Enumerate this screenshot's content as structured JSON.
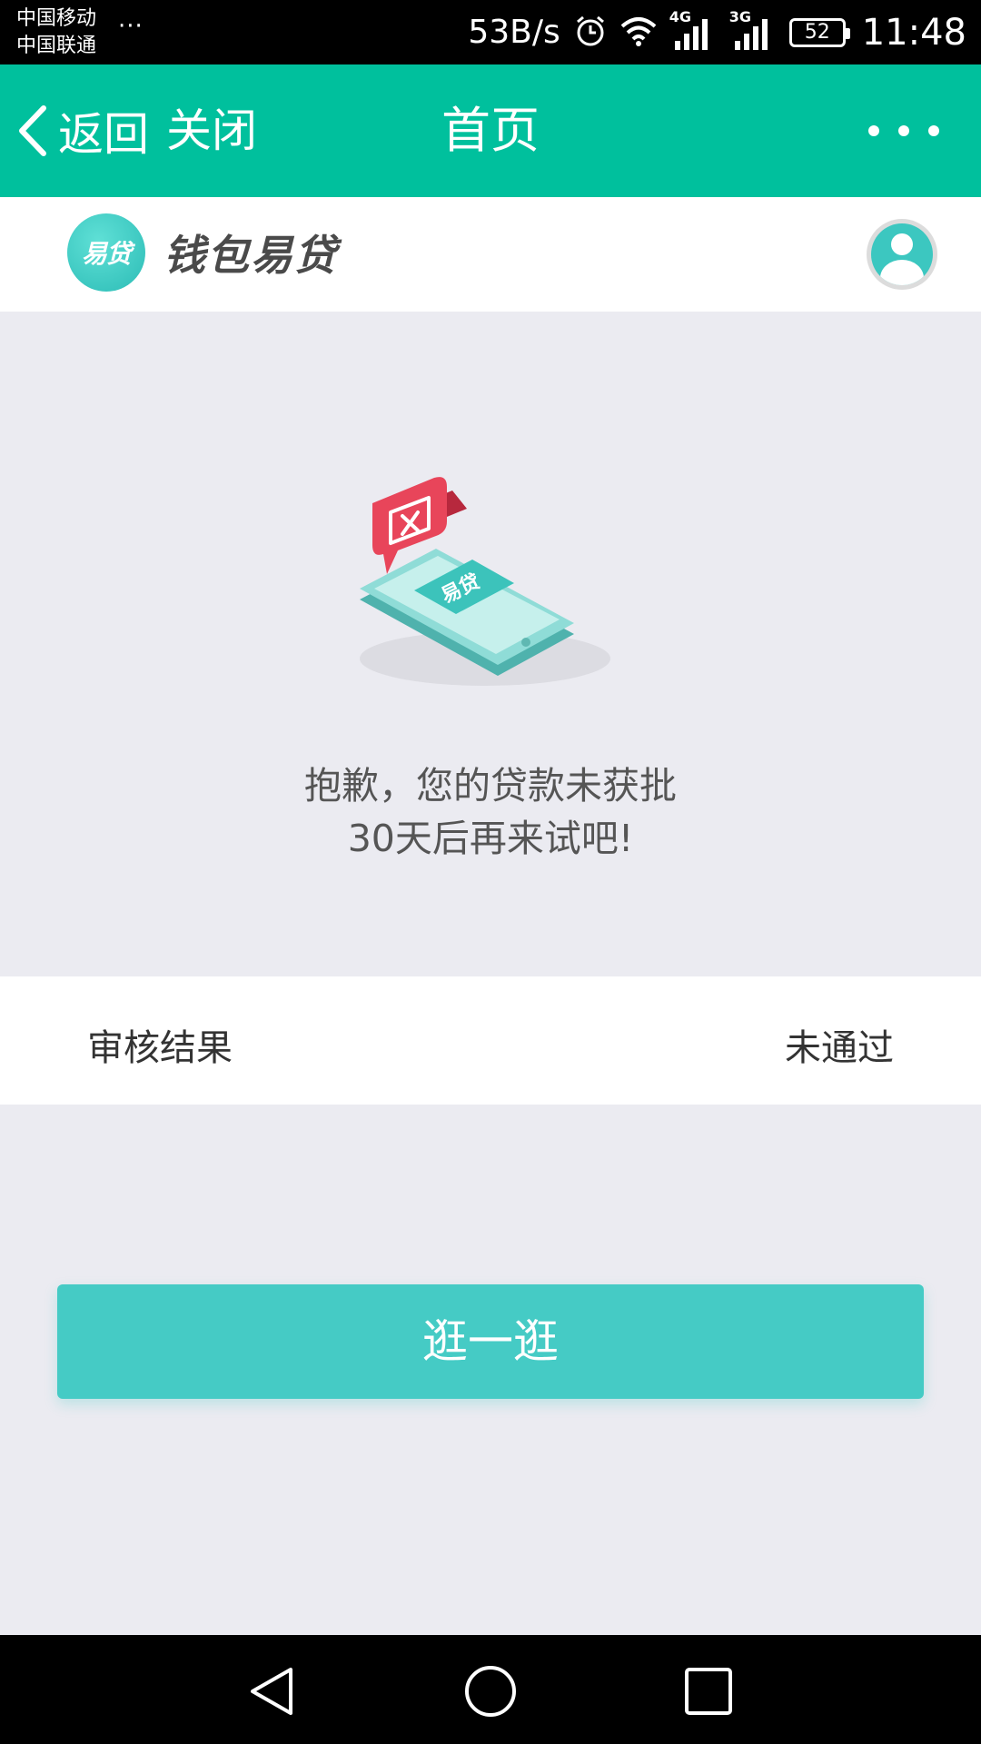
{
  "status_bar": {
    "carrier_1": "中国移动",
    "carrier_2": "中国联通",
    "more": "···",
    "net_speed": "53B/s",
    "sim1_type": "4G",
    "sim2_type": "3G",
    "battery": "52",
    "time": "11:48"
  },
  "nav": {
    "back_label": "返回",
    "close_label": "关闭",
    "title": "首页",
    "more_icon": "more-dots-icon"
  },
  "brand": {
    "logo_text": "易贷",
    "name": "钱包易贷"
  },
  "illustration": {
    "phone_label": "易贷"
  },
  "message": {
    "line1": "抱歉，您的贷款未获批",
    "line2": "30天后再来试吧!"
  },
  "result": {
    "label": "审核结果",
    "value": "未通过"
  },
  "actions": {
    "browse_label": "逛一逛"
  },
  "colors": {
    "nav_bg": "#00c09d",
    "accent": "#45cbc5",
    "page_bg": "#ebebf1",
    "alert": "#e8455a"
  }
}
